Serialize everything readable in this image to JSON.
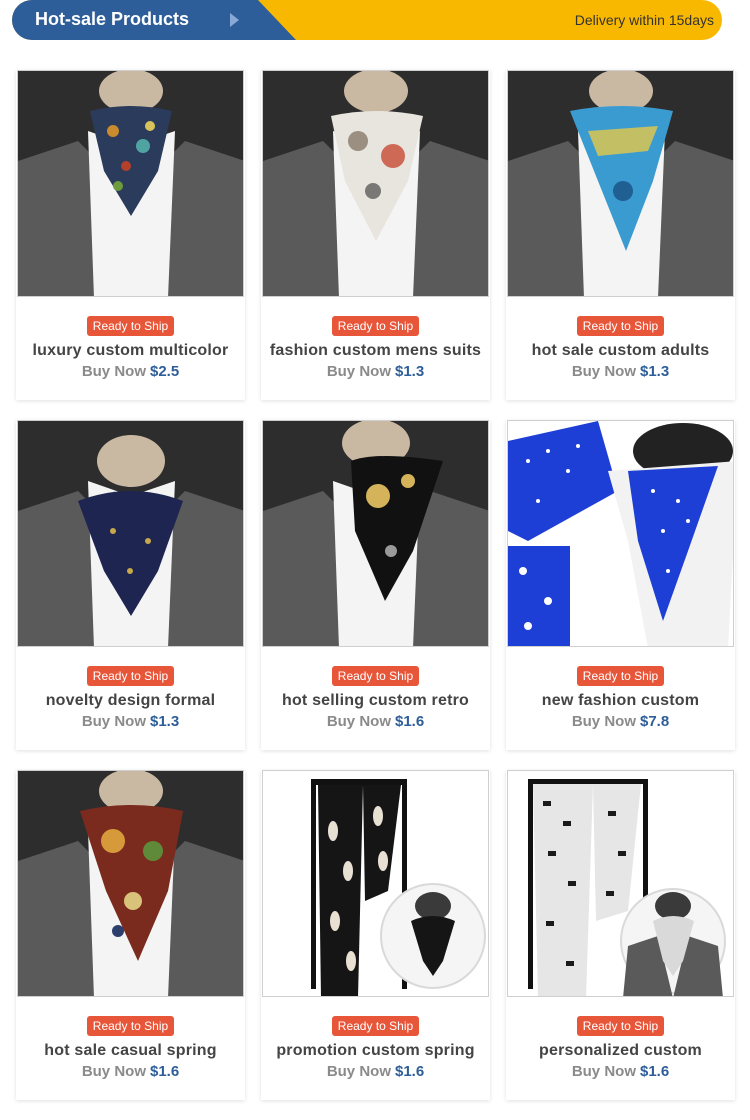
{
  "header": {
    "title": "Hot-sale Products",
    "delivery": "Delivery within 15days"
  },
  "products": [
    {
      "badge": "Ready to Ship",
      "name": "luxury custom multicolor",
      "buy": "Buy Now",
      "price": "$2.5",
      "image": "ascot-multicolor-paisley"
    },
    {
      "badge": "Ready to Ship",
      "name": "fashion custom mens suits",
      "buy": "Buy Now",
      "price": "$1.3",
      "image": "ascot-white-print"
    },
    {
      "badge": "Ready to Ship",
      "name": "hot sale custom adults",
      "buy": "Buy Now",
      "price": "$1.3",
      "image": "ascot-blue-print"
    },
    {
      "badge": "Ready to Ship",
      "name": "novelty design formal",
      "buy": "Buy Now",
      "price": "$1.3",
      "image": "ascot-navy"
    },
    {
      "badge": "Ready to Ship",
      "name": "hot selling custom retro",
      "buy": "Buy Now",
      "price": "$1.6",
      "image": "ascot-black-gold"
    },
    {
      "badge": "Ready to Ship",
      "name": "new fashion custom",
      "buy": "Buy Now",
      "price": "$7.8",
      "image": "ascot-blue-polka-dot"
    },
    {
      "badge": "Ready to Ship",
      "name": "hot sale casual spring",
      "buy": "Buy Now",
      "price": "$1.6",
      "image": "ascot-red-floral"
    },
    {
      "badge": "Ready to Ship",
      "name": "promotion custom spring",
      "buy": "Buy Now",
      "price": "$1.6",
      "image": "ascot-black-feather-scarf"
    },
    {
      "badge": "Ready to Ship",
      "name": "personalized custom",
      "buy": "Buy Now",
      "price": "$1.6",
      "image": "ascot-black-white-scarf"
    }
  ],
  "colors": {
    "banner_blue": "#2e5e99",
    "banner_yellow": "#f9b800",
    "badge_red": "#e8563a",
    "price_blue": "#2e5e99"
  }
}
